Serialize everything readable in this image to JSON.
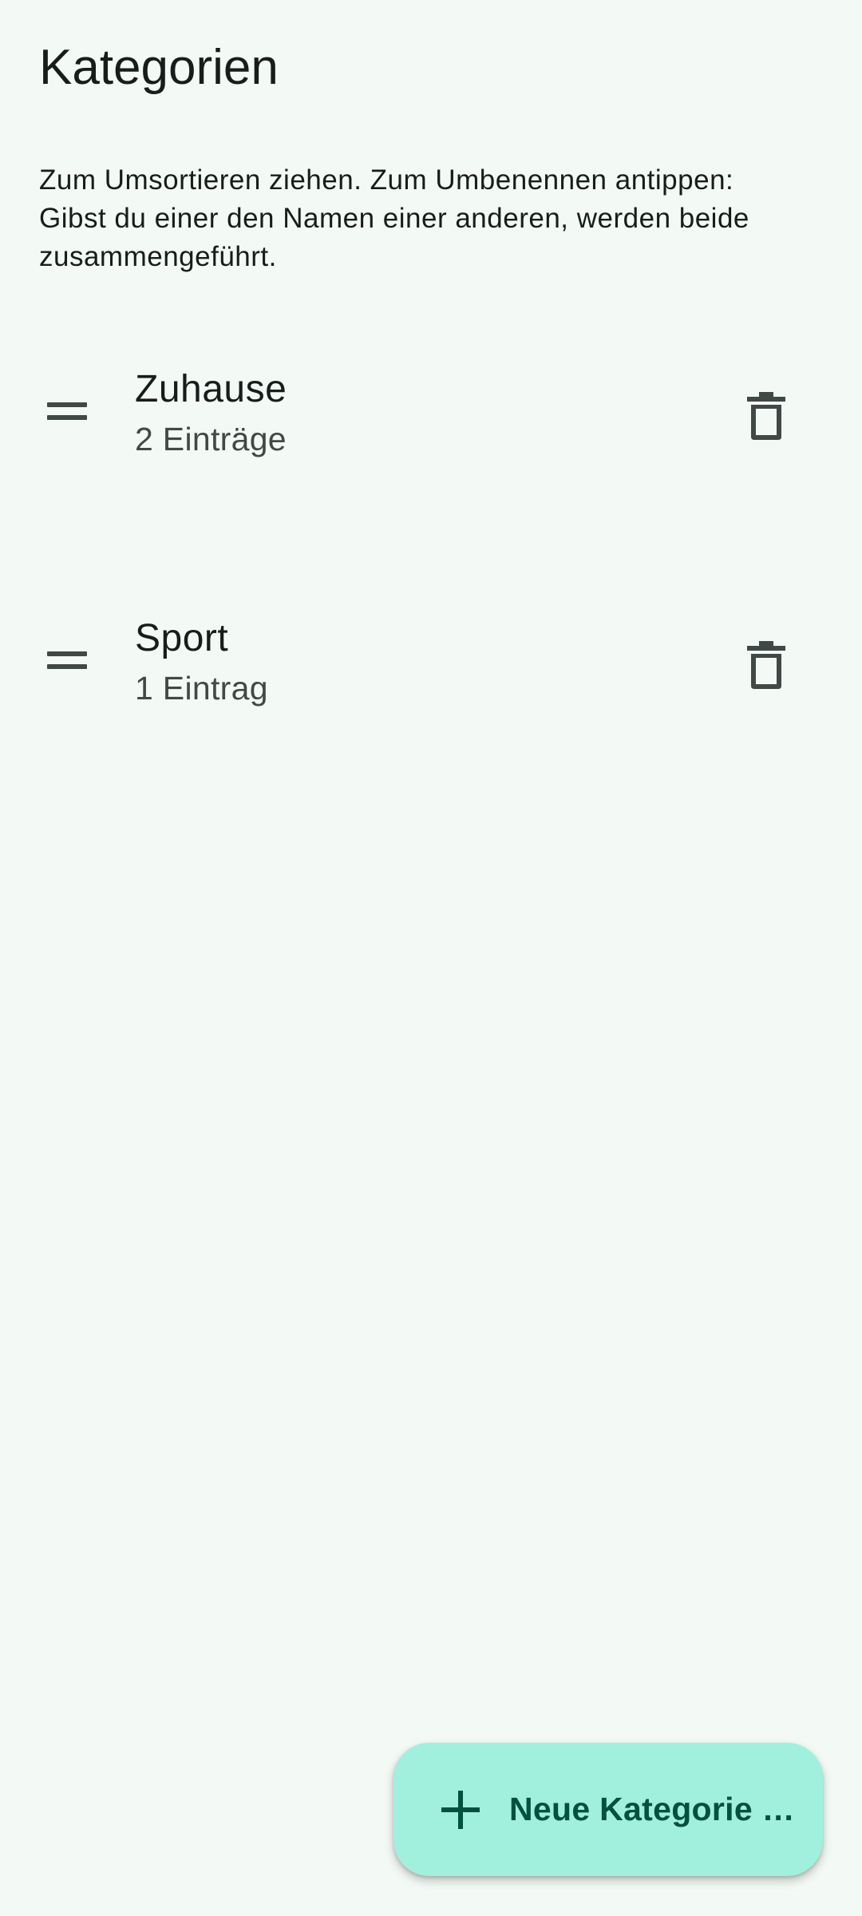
{
  "header": {
    "title": "Kategorien"
  },
  "hint_text": "Zum Umsortieren ziehen. Zum Umbenennen antippen:\nGibst du einer den Namen einer anderen, werden beide\nzusammengeführt.",
  "categories": [
    {
      "name": "Zuhause",
      "count_label": "2 Einträge",
      "drag_icon": "drag-handle-icon",
      "delete_icon": "trash-icon"
    },
    {
      "name": "Sport",
      "count_label": "1 Eintrag",
      "drag_icon": "drag-handle-icon",
      "delete_icon": "trash-icon"
    }
  ],
  "fab": {
    "label": "Neue Kategorie …",
    "icon": "plus-icon"
  },
  "colors": {
    "background": "#f3f9f5",
    "fab_background": "#a1f0dd",
    "fab_text": "#00513f",
    "icon": "#3f4946"
  }
}
